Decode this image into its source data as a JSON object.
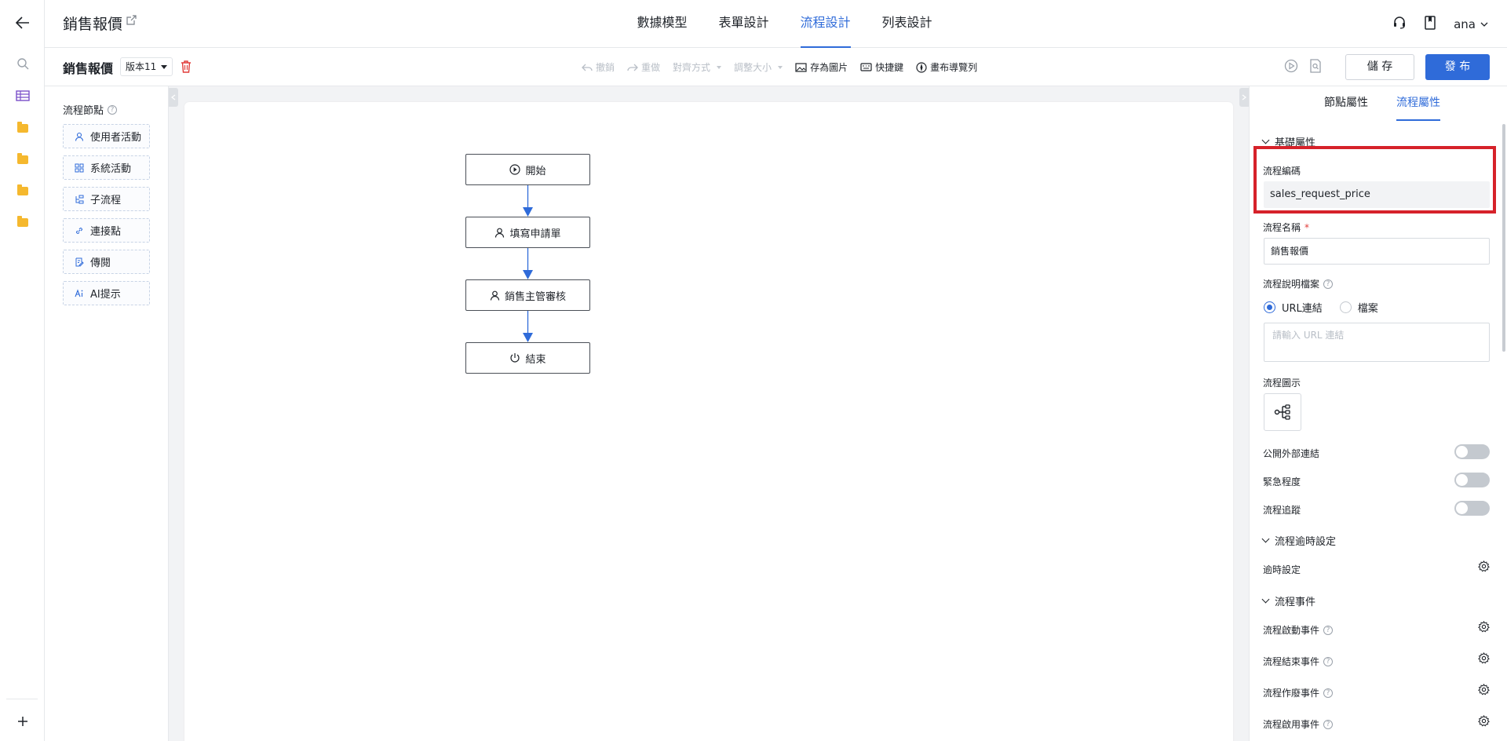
{
  "header": {
    "app_title": "銷售報價",
    "tabs": [
      {
        "label": "數據模型"
      },
      {
        "label": "表單設計"
      },
      {
        "label": "流程設計"
      },
      {
        "label": "列表設計"
      }
    ],
    "user": "ana"
  },
  "toolbar": {
    "process_name": "銷售報價",
    "version": "版本11",
    "undo": "撤銷",
    "redo": "重做",
    "align": "對齊方式",
    "resize": "調整大小",
    "save_image": "存為圖片",
    "shortcuts": "快捷鍵",
    "canvas_nav": "畫布導覽列",
    "save": "儲 存",
    "publish": "發 布"
  },
  "palette": {
    "title": "流程節點",
    "items": [
      {
        "label": "使用者活動",
        "icon": "user-icon"
      },
      {
        "label": "系統活動",
        "icon": "grid-icon"
      },
      {
        "label": "子流程",
        "icon": "subflow-icon"
      },
      {
        "label": "連接點",
        "icon": "link-icon"
      },
      {
        "label": "傳閱",
        "icon": "edit-doc-icon"
      },
      {
        "label": "AI提示",
        "icon": "ai-icon"
      }
    ]
  },
  "flow": {
    "nodes": [
      {
        "label": "開始",
        "icon": "play-icon"
      },
      {
        "label": "填寫申請單",
        "icon": "user-icon"
      },
      {
        "label": "銷售主管審核",
        "icon": "user-icon"
      },
      {
        "label": "結束",
        "icon": "power-icon"
      }
    ]
  },
  "panel": {
    "tabs": [
      {
        "label": "節點屬性"
      },
      {
        "label": "流程屬性"
      }
    ],
    "basic_section": "基礎屬性",
    "code_label": "流程編碼",
    "code_value": "sales_request_price",
    "name_label": "流程名稱",
    "name_required": "*",
    "name_value": "銷售報價",
    "doc_label": "流程說明檔案",
    "radio_url": "URL連結",
    "radio_file": "檔案",
    "url_placeholder": "請輸入 URL 連結",
    "icon_label": "流程圖示",
    "toggles": [
      {
        "label": "公開外部連結",
        "on": false
      },
      {
        "label": "緊急程度",
        "on": false
      },
      {
        "label": "流程追蹤",
        "on": false
      }
    ],
    "timeout_section": "流程逾時設定",
    "timeout_label": "逾時設定",
    "events_section": "流程事件",
    "events": [
      {
        "label": "流程啟動事件"
      },
      {
        "label": "流程結束事件"
      },
      {
        "label": "流程作廢事件"
      },
      {
        "label": "流程啟用事件"
      }
    ]
  },
  "colors": {
    "accent": "#2f6bd9",
    "highlight": "#d6222a",
    "folder": "#f5b82e"
  }
}
